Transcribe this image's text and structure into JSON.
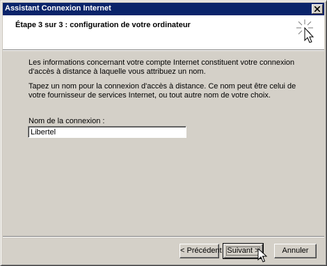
{
  "window": {
    "title": "Assistant Connexion Internet"
  },
  "header": {
    "title": "Étape 3 sur 3 : configuration de votre ordinateur"
  },
  "content": {
    "paragraph1": "Les informations concernant votre compte Internet constituent votre connexion d'accès à distance à laquelle vous attribuez un nom.",
    "paragraph2": "Tapez un nom pour la connexion d'accès à distance. Ce nom peut être celui de votre fournisseur de services Internet, ou tout autre nom de votre choix.",
    "field_label": "Nom de la connexion :",
    "field_value": "Libertel"
  },
  "buttons": {
    "back": "< Précédent",
    "next": "Suivant >",
    "cancel": "Annuler"
  },
  "icons": {
    "close": "close-icon",
    "wizard": "wizard-sparkle-icon",
    "cursor": "mouse-pointer-icon"
  },
  "colors": {
    "titlebar": "#0a246a",
    "face": "#d4d0c8",
    "header_bg": "#ffffff"
  }
}
